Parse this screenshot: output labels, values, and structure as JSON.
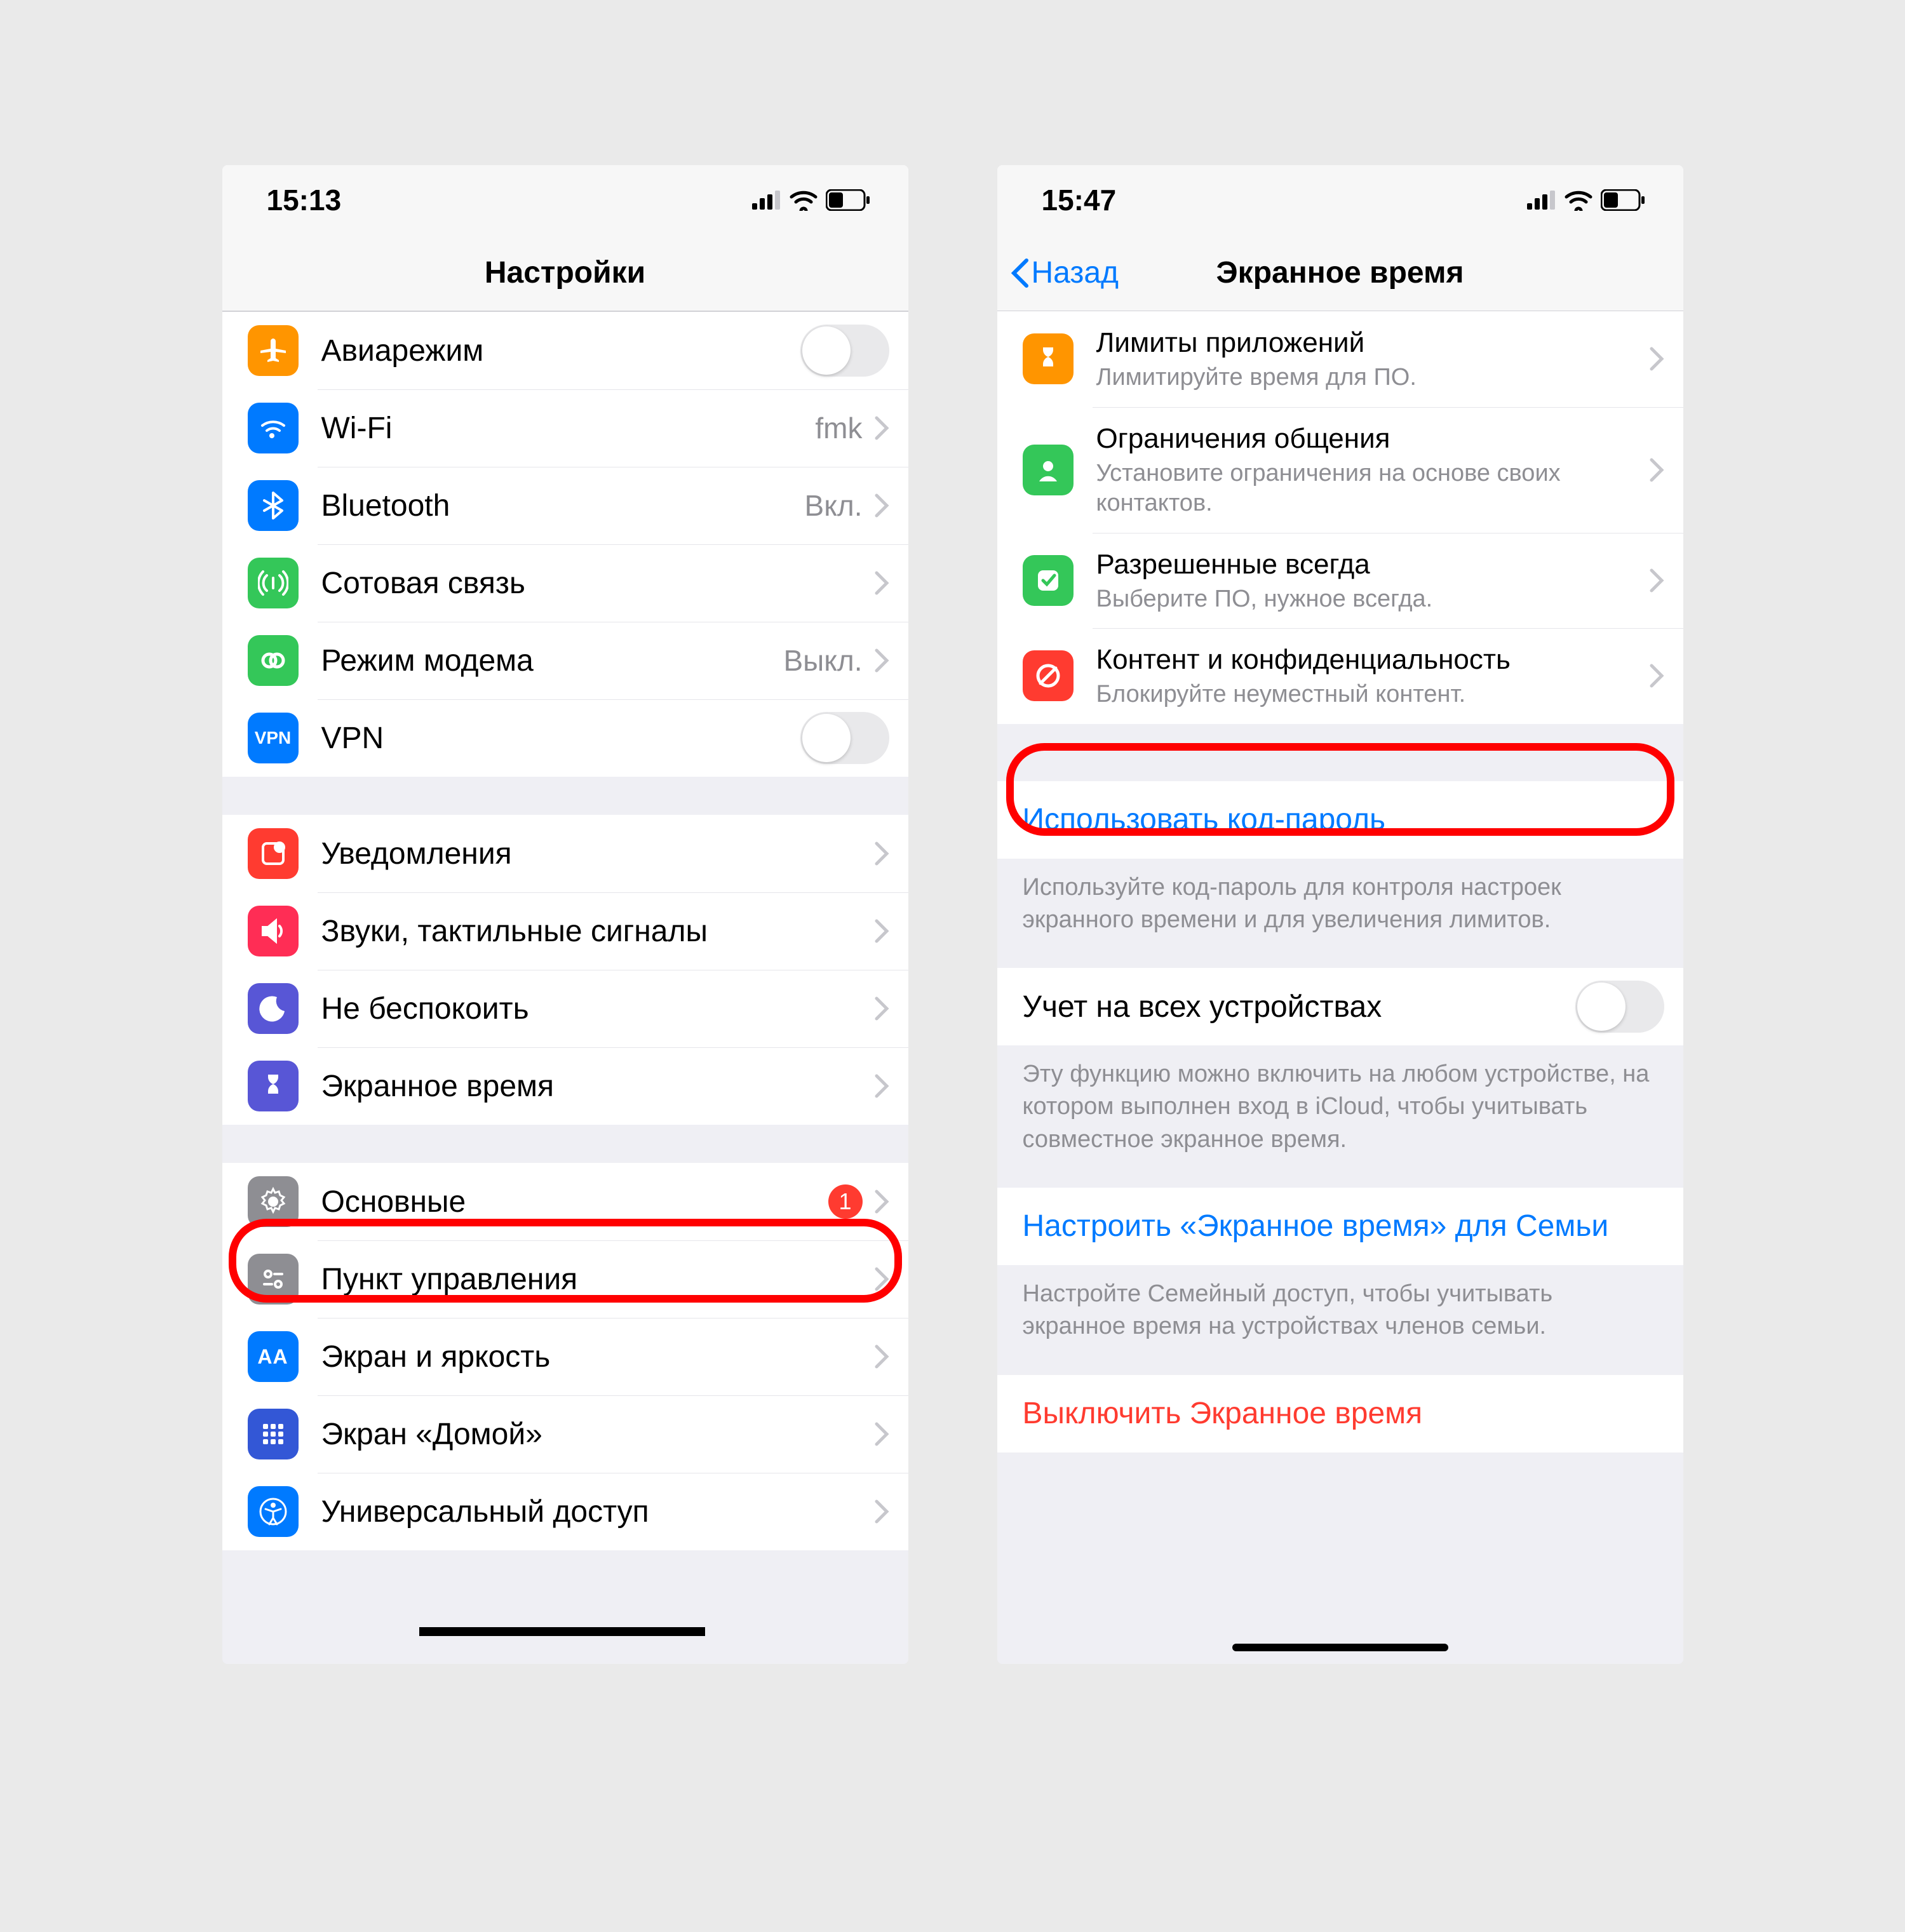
{
  "left": {
    "status_time": "15:13",
    "nav_title": "Настройки",
    "g1": {
      "airplane": "Авиарежим",
      "wifi": "Wi-Fi",
      "wifi_value": "fmk",
      "bluetooth": "Bluetooth",
      "bluetooth_value": "Вкл.",
      "cellular": "Сотовая связь",
      "hotspot": "Режим модема",
      "hotspot_value": "Выкл.",
      "vpn": "VPN"
    },
    "g2": {
      "notifications": "Уведомления",
      "sounds": "Звуки, тактильные сигналы",
      "dnd": "Не беспокоить",
      "screentime": "Экранное время"
    },
    "g3": {
      "general": "Основные",
      "general_badge": "1",
      "control": "Пункт управления",
      "display": "Экран и яркость",
      "home": "Экран «Домой»",
      "accessibility": "Универсальный доступ"
    }
  },
  "right": {
    "status_time": "15:47",
    "nav_back": "Назад",
    "nav_title": "Экранное время",
    "items": {
      "limits_t": "Лимиты приложений",
      "limits_s": "Лимитируйте время для ПО.",
      "comm_t": "Ограничения общения",
      "comm_s": "Установите ограничения на основе своих контактов.",
      "allowed_t": "Разрешенные всегда",
      "allowed_s": "Выберите ПО, нужное всегда.",
      "content_t": "Контент и конфиденциальность",
      "content_s": "Блокируйте неуместный контент."
    },
    "passcode": "Использовать код-пароль",
    "passcode_footer": "Используйте код-пароль для контроля настроек экранного времени и для увеличения лимитов.",
    "share": "Учет на всех устройствах",
    "share_footer": "Эту функцию можно включить на любом устройстве, на котором выполнен вход в iCloud, чтобы учитывать совместное экранное время.",
    "family": "Настроить «Экранное время» для Семьи",
    "family_footer": "Настройте Семейный доступ, чтобы учитывать экранное время на устройствах членов семьи.",
    "turnoff": "Выключить Экранное время"
  }
}
